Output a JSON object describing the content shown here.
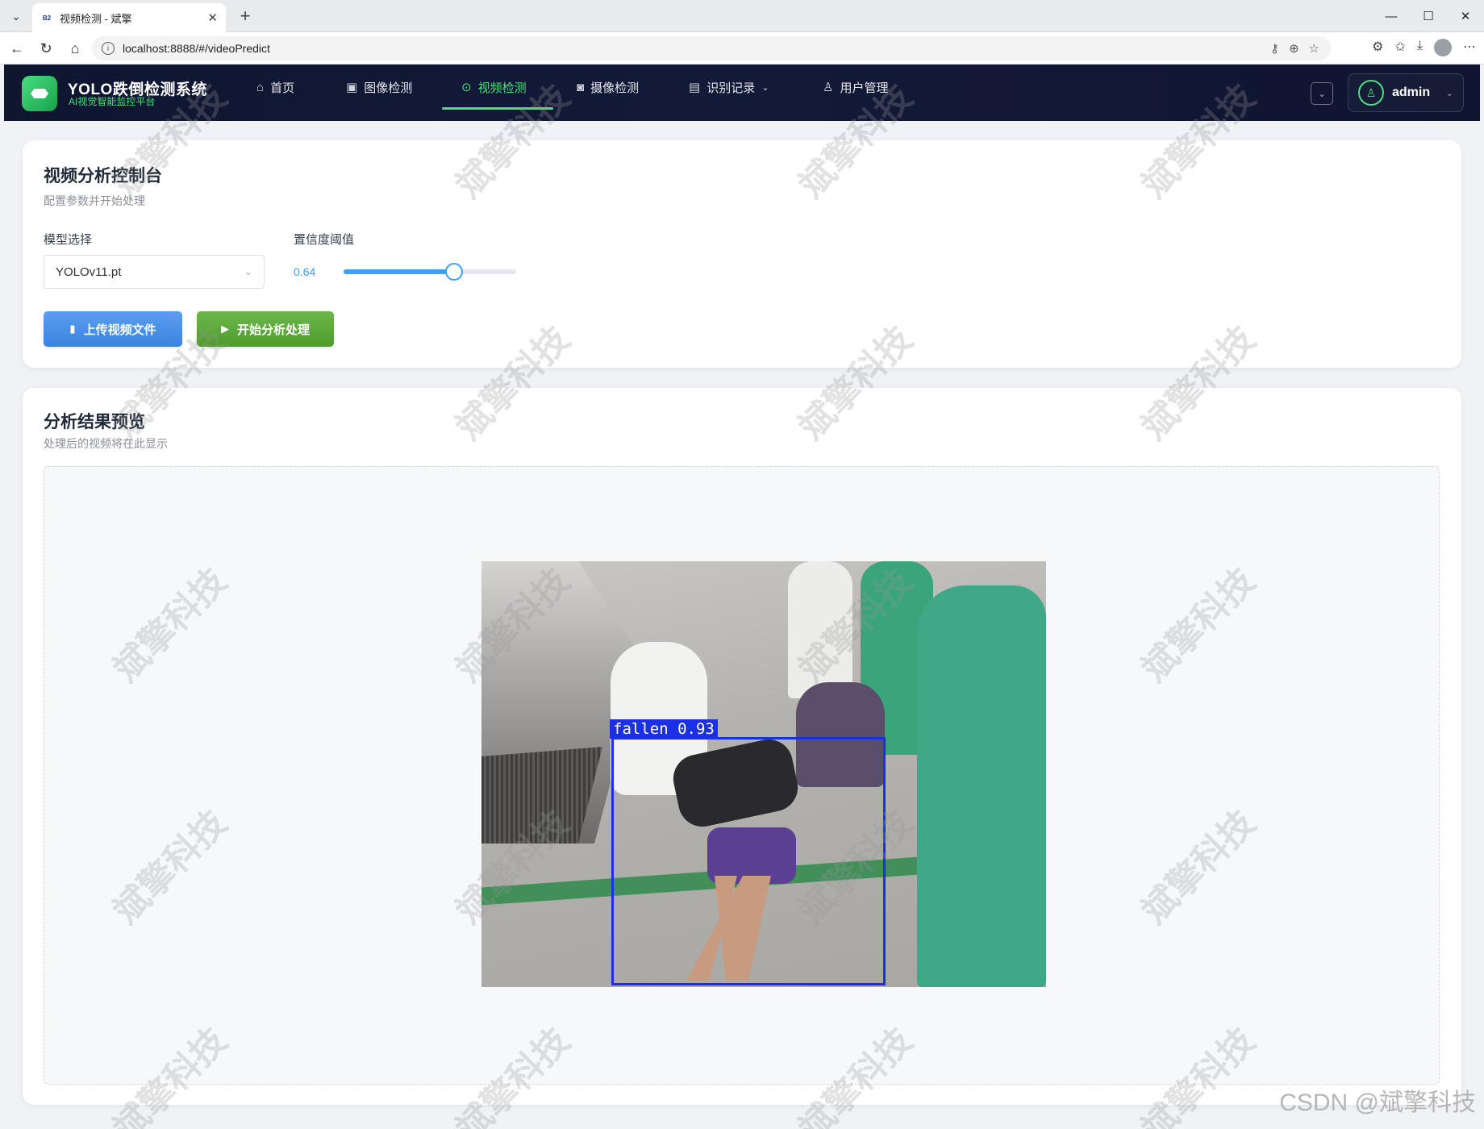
{
  "browser": {
    "tab_title": "视频检测 - 斌擎",
    "tab_favicon": "B2",
    "url": "localhost:8888/#/videoPredict"
  },
  "app": {
    "brand_title": "YOLO跌倒检测系统",
    "brand_subtitle": "AI视觉智能监控平台",
    "nav": [
      {
        "label": "首页",
        "icon": "home-icon"
      },
      {
        "label": "图像检测",
        "icon": "image-icon"
      },
      {
        "label": "视频检测",
        "icon": "play-circle-icon",
        "active": true
      },
      {
        "label": "摄像检测",
        "icon": "camera-icon"
      },
      {
        "label": "识别记录",
        "icon": "document-icon",
        "has_dropdown": true
      },
      {
        "label": "用户管理",
        "icon": "user-icon"
      }
    ],
    "user": "admin",
    "accent_color": "#4ade80"
  },
  "control_panel": {
    "title": "视频分析控制台",
    "subtitle": "配置参数并开始处理",
    "model_label": "模型选择",
    "model_value": "YOLOv11.pt",
    "confidence_label": "置信度阈值",
    "confidence_value": "0.64",
    "confidence_fraction": 0.64,
    "upload_button": "上传视频文件",
    "start_button": "开始分析处理"
  },
  "result_panel": {
    "title": "分析结果预览",
    "subtitle": "处理后的视频将在此显示",
    "detection_label": "fallen 0.93"
  },
  "watermark": "斌擎科技",
  "csdn_watermark": "CSDN @斌擎科技"
}
